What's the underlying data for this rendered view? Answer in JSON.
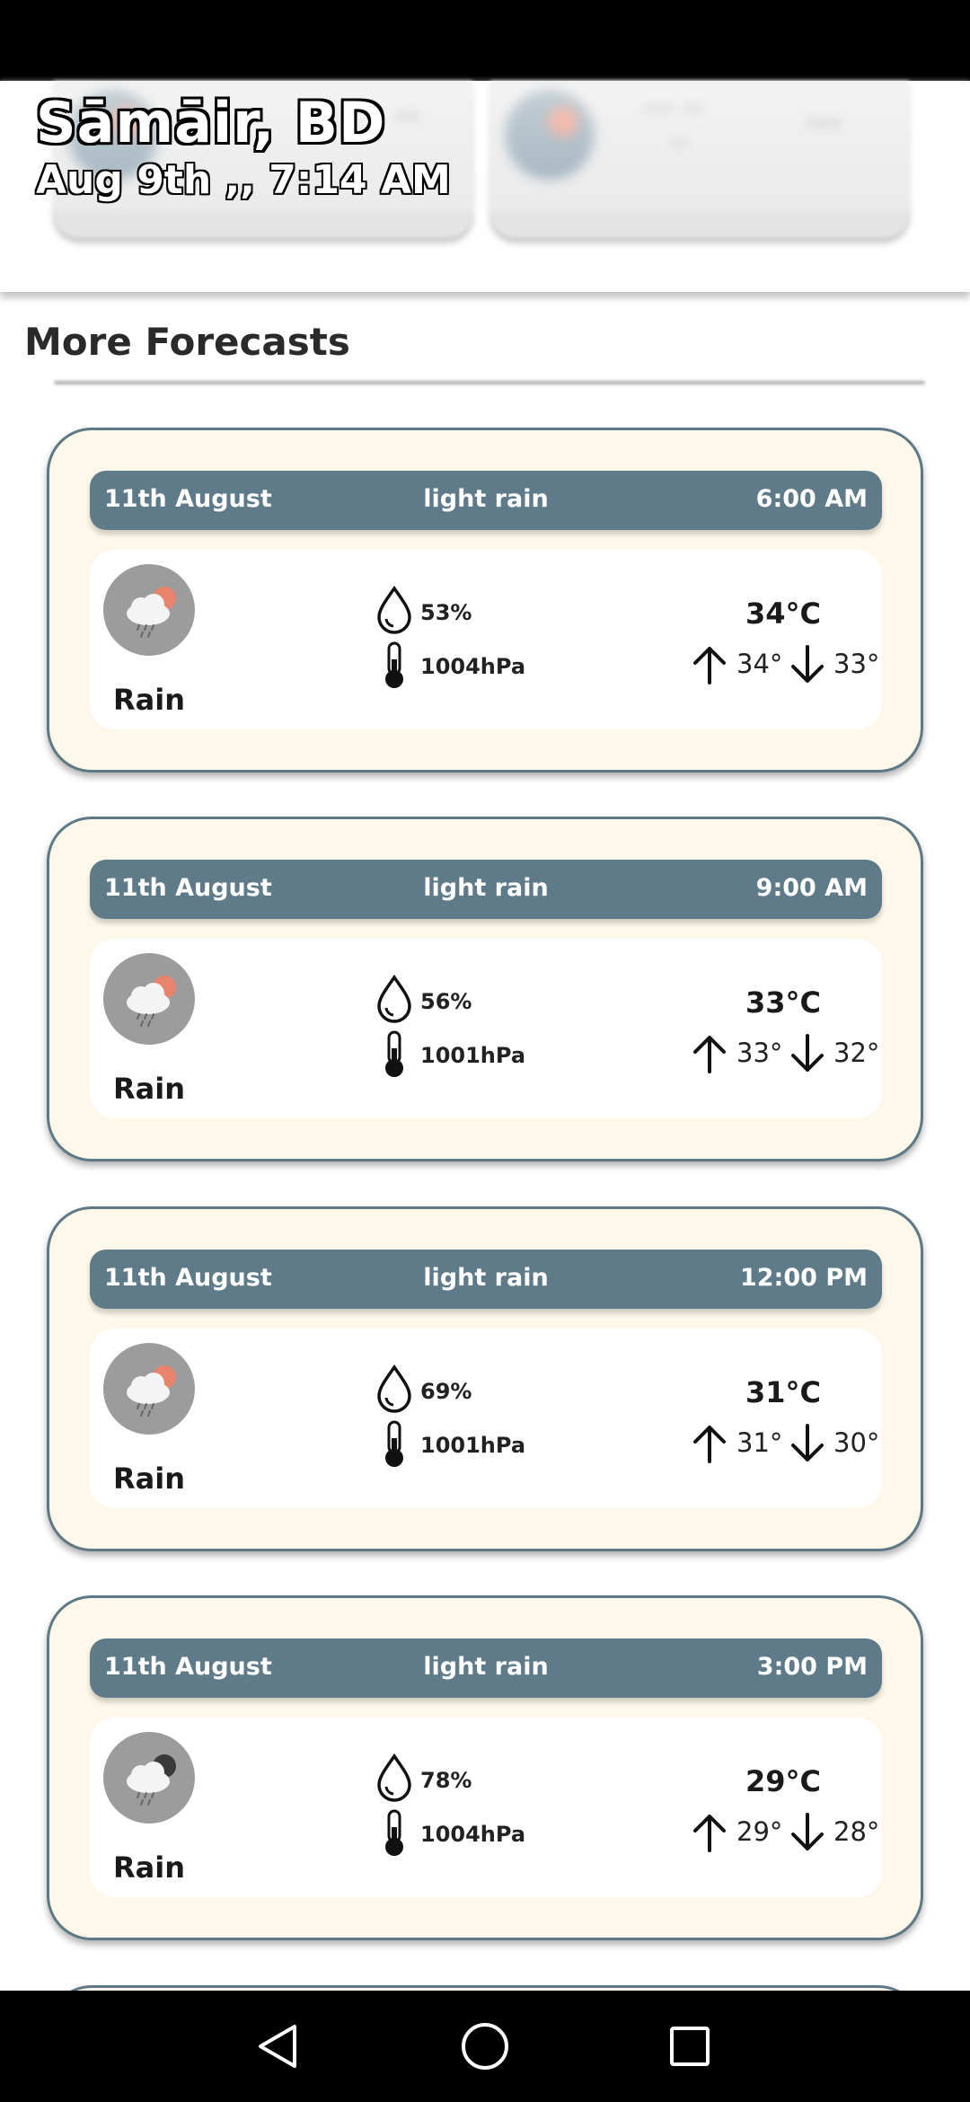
{
  "header": {
    "location": "Sāmāir, BD",
    "datetime": "Aug 9th ,, 7:14 AM"
  },
  "section": {
    "title": "More Forecasts"
  },
  "forecasts": [
    {
      "date": "11th August",
      "description": "light rain",
      "time": "6:00 AM",
      "condition": "Rain",
      "icon": "rain-day-icon",
      "humidity": "53%",
      "pressure": "1004hPa",
      "temp": "34°C",
      "high": "34°",
      "low": "33°"
    },
    {
      "date": "11th August",
      "description": "light rain",
      "time": "9:00 AM",
      "condition": "Rain",
      "icon": "rain-day-icon",
      "humidity": "56%",
      "pressure": "1001hPa",
      "temp": "33°C",
      "high": "33°",
      "low": "32°"
    },
    {
      "date": "11th August",
      "description": "light rain",
      "time": "12:00 PM",
      "condition": "Rain",
      "icon": "rain-day-icon",
      "humidity": "69%",
      "pressure": "1001hPa",
      "temp": "31°C",
      "high": "31°",
      "low": "30°"
    },
    {
      "date": "11th August",
      "description": "light rain",
      "time": "3:00 PM",
      "condition": "Rain",
      "icon": "rain-night-icon",
      "humidity": "78%",
      "pressure": "1004hPa",
      "temp": "29°C",
      "high": "29°",
      "low": "28°"
    }
  ],
  "colors": {
    "card_background": "#fdf8ea",
    "card_border": "#5e7885",
    "header_bar": "#5f7b89",
    "sun": "#e8836c",
    "moon": "#3a3a3a"
  },
  "nav": {
    "back_icon": "back-triangle-icon",
    "home_icon": "home-circle-icon",
    "recents_icon": "recents-square-icon"
  }
}
